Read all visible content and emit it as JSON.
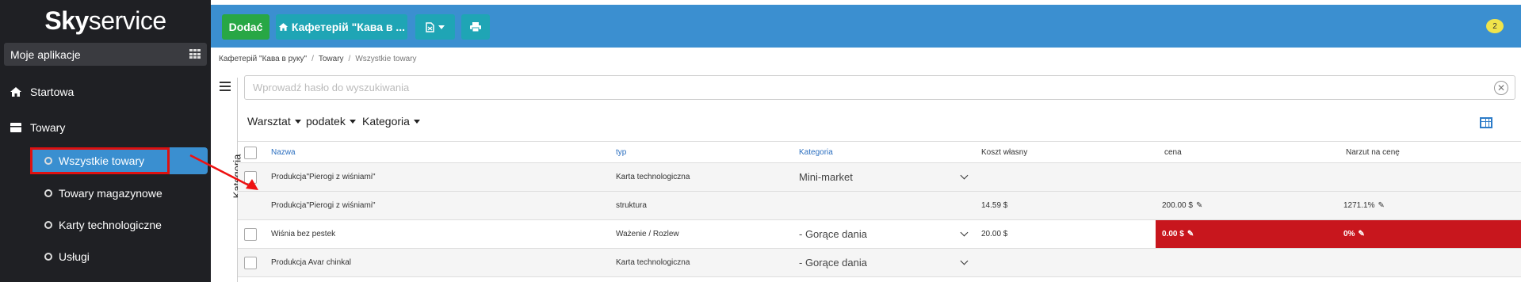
{
  "brand": {
    "name_bold": "Sky",
    "name_rest": "service"
  },
  "sidebar": {
    "apps_label": "Moje aplikacje",
    "items": [
      {
        "label": "Startowa",
        "icon": "home-icon"
      },
      {
        "label": "Towary",
        "icon": "box-icon"
      }
    ],
    "subitems": [
      {
        "label": "Wszystkie towary",
        "active": true
      },
      {
        "label": "Towary magazynowe"
      },
      {
        "label": "Karty technologiczne"
      },
      {
        "label": "Usługi"
      }
    ]
  },
  "toolbar": {
    "add_label": "Dodać",
    "store_label": "Кафетерій \"Кава в ...",
    "export_icon": "file-export-icon",
    "print_icon": "print-icon",
    "notifications_count": "2"
  },
  "breadcrumb": [
    "Кафетерій \"Кава в руку\"",
    "Towary",
    "Wszystkie towary"
  ],
  "panel": {
    "side_label": "Kategoria"
  },
  "search": {
    "placeholder": "Wprowadź hasło do wyszukiwania"
  },
  "filters": [
    "Warsztat",
    "podatek",
    "Kategoria"
  ],
  "table": {
    "columns": [
      "Nazwa",
      "typ",
      "Kategoria",
      "Koszt własny",
      "cena",
      "Narzut na cenę"
    ],
    "rows": [
      {
        "name": "Produkcja\"Pierogi z wiśniami\"",
        "type": "Karta technologiczna",
        "category": "Mini-market",
        "cost": "",
        "price": "",
        "markup": ""
      },
      {
        "name": "Produkcja\"Pierogi z wiśniami\"",
        "type": "struktura",
        "category": "",
        "cost": "14.59 $",
        "price": "200.00 $",
        "markup": "1271.1%"
      },
      {
        "name": "Wiśnia bez pestek",
        "type": "Ważenie / Rozlew",
        "category": "- Gorące dania",
        "cost": "20.00 $",
        "price": "0.00 $",
        "markup": "0%"
      },
      {
        "name": "Produkcja Avar chinkal",
        "type": "Karta technologiczna",
        "category": "- Gorące dania",
        "cost": "",
        "price": "",
        "markup": ""
      }
    ]
  },
  "colors": {
    "topbar": "#3b8fd0",
    "add": "#28a745",
    "teal": "#1fa5b5",
    "alert": "#c8161d",
    "sidebar": "#1f2024"
  }
}
